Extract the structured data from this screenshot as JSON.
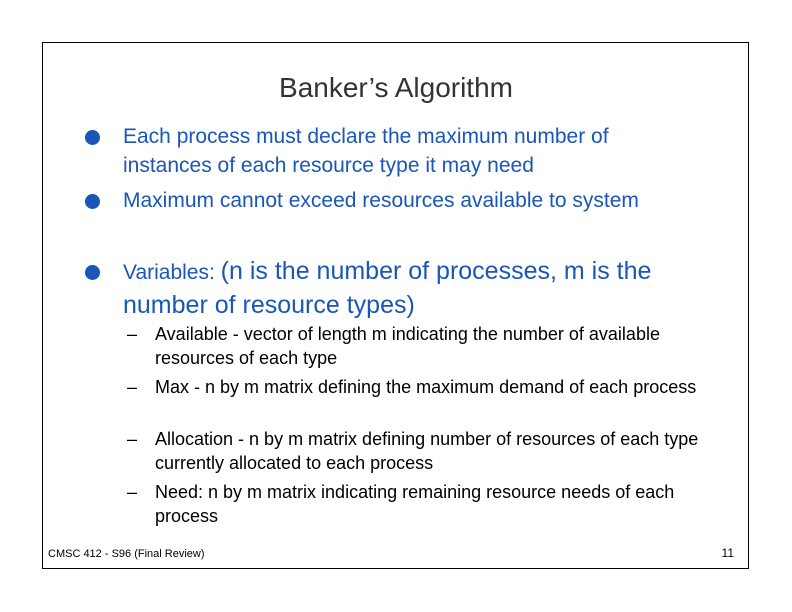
{
  "slide": {
    "title": "Banker’s Algorithm",
    "bullets": [
      {
        "text": "Each process must declare the maximum number of instances of each resource type it may need"
      },
      {
        "text": "Maximum cannot exceed resources available to system"
      },
      {
        "prefix": "Variables:",
        "text": "(n is the number of processes, m is the number of resource types)"
      }
    ],
    "subitems": [
      "Available  - vector of length m indicating the number of available resources of each type",
      "Max - n by m matrix defining the maximum demand of each process",
      "Allocation - n by m matrix defining number of resources of each type currently allocated to each process",
      "Need: n by m matrix indicating remaining resource needs of each process"
    ],
    "dash": "–",
    "footer": "CMSC 412 - S96  (Final Review)",
    "page_number": "11"
  },
  "colors": {
    "bullet_text": "#1a56b8",
    "title": "#333333"
  }
}
